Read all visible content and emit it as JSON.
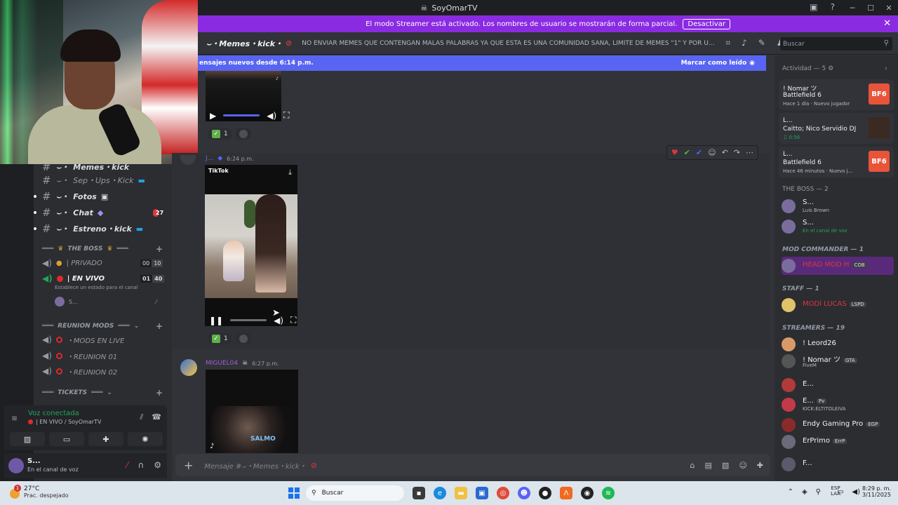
{
  "window": {
    "title": "SoyOmarTV"
  },
  "streamer_banner": {
    "text": "El modo Streamer está activado. Los nombres de usuario se mostrarán de forma parcial.",
    "button": "Desactivar"
  },
  "channels": [
    {
      "name": "Memes・kick",
      "prefix": "⌣・"
    },
    {
      "name": "Sep・Ups・Kick",
      "prefix": "⌣・"
    },
    {
      "name": "Fotos",
      "prefix": "⌣・"
    },
    {
      "name": "Chat",
      "prefix": "⌣・",
      "badge": "27"
    },
    {
      "name": "Estreno・kick",
      "prefix": "⌣・"
    }
  ],
  "categories": {
    "the_boss": "THE BOSS",
    "reunion": "REUNION MODS",
    "tickets": "TICKETS"
  },
  "voice_channels": [
    {
      "name": "| PRIVADO",
      "a": "00",
      "b": "10"
    },
    {
      "name": "| EN VIVO",
      "a": "01",
      "b": "40",
      "status": "Establece un estado para el canal",
      "member": "S..."
    },
    {
      "name": "・MODS EN LIVE"
    },
    {
      "name": "・REUNION 01"
    },
    {
      "name": "・REUNION 02"
    }
  ],
  "voice_panel": {
    "status": "Voz conectada",
    "location": "| EN VIVO / SoyOmarTV"
  },
  "user_panel": {
    "name": "S...",
    "status": "En el canal de voz"
  },
  "header": {
    "channel": "⌣・Memes・kick・",
    "topic": "NO ENVIAR MEMES QUE CONTENGAN MALAS PALABRAS YA QUE ESTA ES UNA COMUNIDAD SANA, LIMITE DE MEMES \"1\" Y POR ULTIMO EL ...",
    "search_placeholder": "Buscar"
  },
  "new_messages": {
    "text": "ensajes nuevos desde 6:14 p.m.",
    "mark": "Marcar como leído"
  },
  "messages": [
    {
      "reaction_count": "1"
    },
    {
      "author": "J...",
      "time": "6:24 p.m.",
      "tiktok": "TikTok",
      "reaction_count": "1"
    },
    {
      "author": "MIGUEL04",
      "time": "6:27 p.m.",
      "overlay": "SALMO"
    }
  ],
  "composer": {
    "placeholder": "Mensaje #⌣・Memes・kick・"
  },
  "members": {
    "activity_header": "Actividad — 5",
    "activity": [
      {
        "name": "! Nomar ツ",
        "game": "Battlefield 6",
        "sub": "Hace 1 día · Nuevo jugador",
        "art": "BF6"
      },
      {
        "name": "L...",
        "game": "Caitto; Nico Servidio DJ",
        "sub": "0:56",
        "art": ""
      },
      {
        "name": "L...",
        "game": "Battlefield 6",
        "sub": "Hace 46 minutos · Nuevo j...",
        "art": "BF6"
      }
    ],
    "the_boss": "THE BOSS — 2",
    "boss_members": [
      {
        "name": "S...",
        "status": "Luis Brown"
      },
      {
        "name": "S...",
        "status": "En el canal de voz"
      }
    ],
    "mod_commander": "MOD COMMANDER — 1",
    "mod_member": {
      "name": "HEAD MOD H",
      "tag": "COB"
    },
    "staff": "STAFF — 1",
    "staff_member": {
      "name": "MODl LUCAS",
      "tag": "LSPD"
    },
    "streamers": "STREAMERS — 19",
    "streamer_members": [
      {
        "name": "! Leord26",
        "status": ""
      },
      {
        "name": "! Nomar ツ",
        "tag": "GTA",
        "status": "FiveM"
      },
      {
        "name": "E...",
        "status": ""
      },
      {
        "name": "E...",
        "tag": "Pv",
        "status": "KICK:ELTITOLEIVA"
      },
      {
        "name": "Endy Gaming Pro",
        "tag": "EGP",
        "status": ""
      },
      {
        "name": "ErPrimo",
        "tag": "ErrP",
        "status": ""
      },
      {
        "name": "F...",
        "status": ""
      }
    ]
  },
  "taskbar": {
    "temp": "27°C",
    "weather": "Prac. despejado",
    "notif": "1",
    "search": "Buscar",
    "lang1": "ESP",
    "lang2": "LAA",
    "time": "8:29 p. m.",
    "date": "3/11/2025"
  }
}
